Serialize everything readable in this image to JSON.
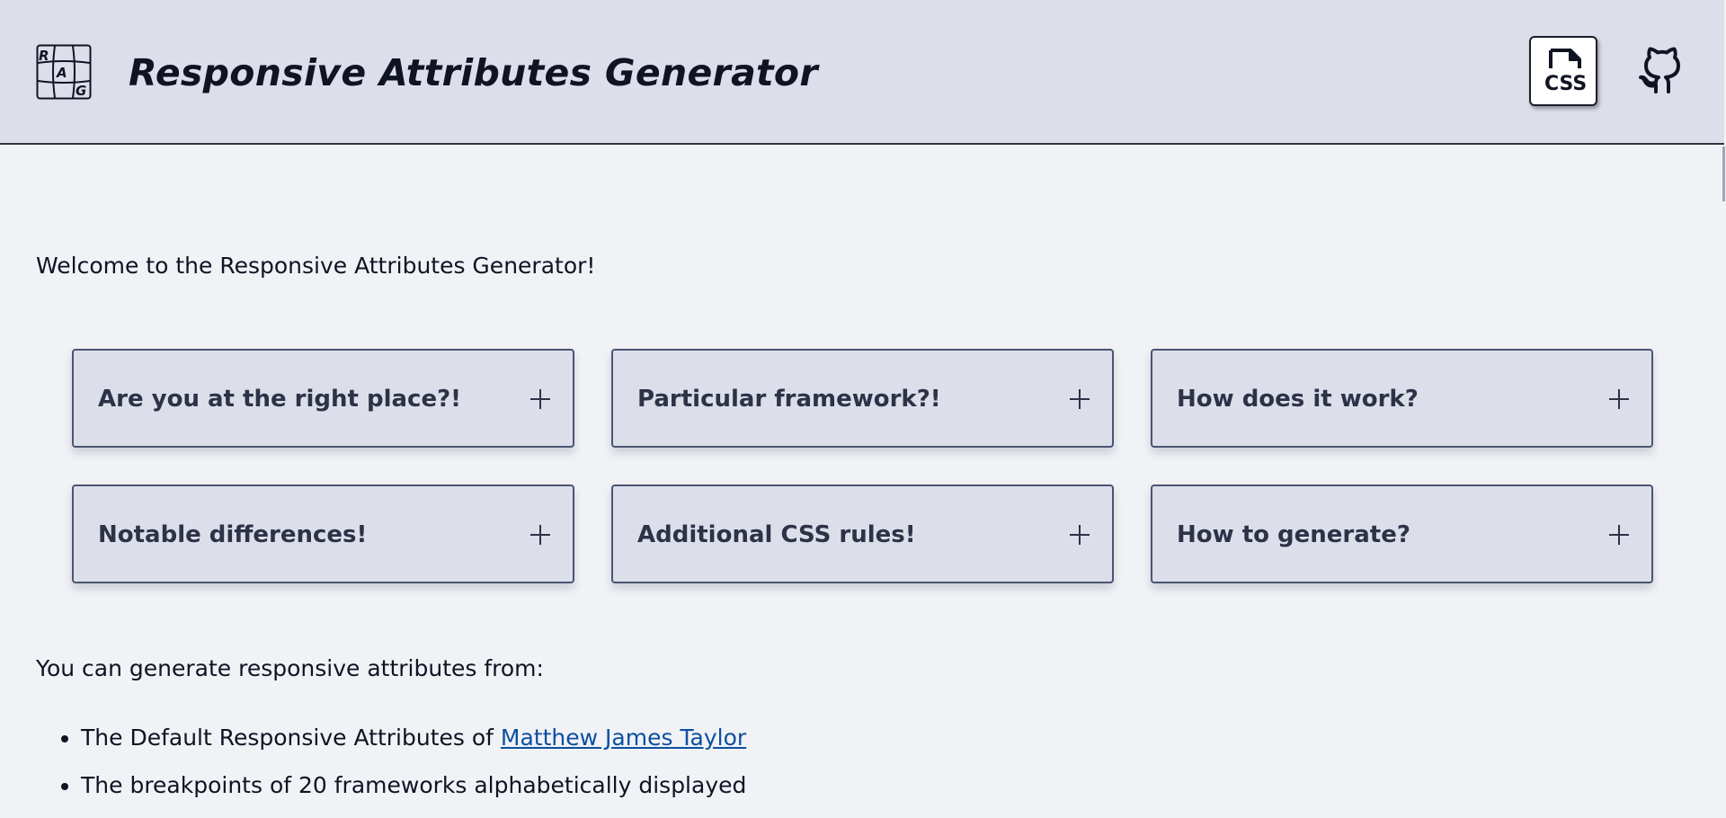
{
  "header": {
    "title": "Responsive Attributes Generator",
    "logo_icon": "rag-grid-logo",
    "logo_letters": [
      "R",
      "A",
      "G"
    ],
    "css_button_icon": "css-file-icon",
    "css_button_label": "CSS",
    "github_icon": "github-icon"
  },
  "main": {
    "welcome": "Welcome to the Responsive Attributes Generator!",
    "cards": [
      {
        "title": "Are you at the right place?!",
        "icon": "plus-icon"
      },
      {
        "title": "Particular framework?!",
        "icon": "plus-icon"
      },
      {
        "title": "How does it work?",
        "icon": "plus-icon"
      },
      {
        "title": "Notable differences!",
        "icon": "plus-icon"
      },
      {
        "title": "Additional CSS rules!",
        "icon": "plus-icon"
      },
      {
        "title": "How to generate?",
        "icon": "plus-icon"
      }
    ],
    "sources_intro": "You can generate responsive attributes from:",
    "sources": [
      {
        "text": "The Default Responsive Attributes of ",
        "link": "Matthew James Taylor"
      },
      {
        "text": "The breakpoints of 20 frameworks alphabetically displayed"
      }
    ]
  },
  "colors": {
    "page_bg": "#f0f2f6",
    "header_bg": "#dcdfea",
    "card_bg": "#dcdfea",
    "card_border": "#4b5573",
    "text": "#101322",
    "card_text": "#2d3247",
    "link": "#0c4fa0"
  }
}
